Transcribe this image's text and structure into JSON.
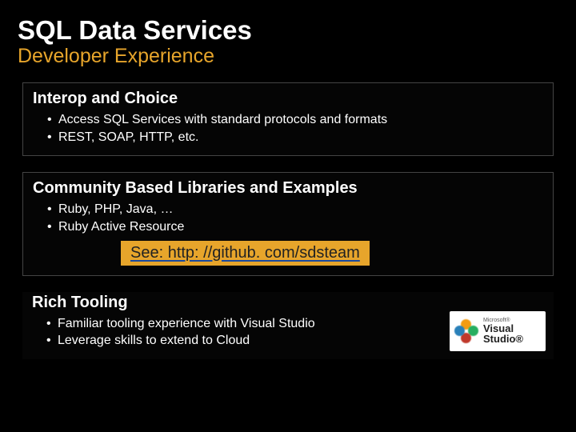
{
  "title": "SQL Data Services",
  "subtitle": "Developer Experience",
  "sections": {
    "interop": {
      "heading": "Interop and Choice",
      "items": [
        "Access SQL Services with standard protocols and formats",
        "REST, SOAP, HTTP, etc."
      ]
    },
    "community": {
      "heading": "Community Based Libraries and Examples",
      "items": [
        "Ruby, PHP, Java, …",
        "Ruby Active Resource"
      ],
      "link_label": "See: http: //github. com/sdsteam"
    },
    "tooling": {
      "heading": "Rich Tooling",
      "items": [
        "Familiar tooling experience with Visual Studio",
        "Leverage skills to extend to Cloud"
      ]
    }
  },
  "logo": {
    "brand_small": "Microsoft®",
    "brand_main": "Visual Studio®"
  }
}
